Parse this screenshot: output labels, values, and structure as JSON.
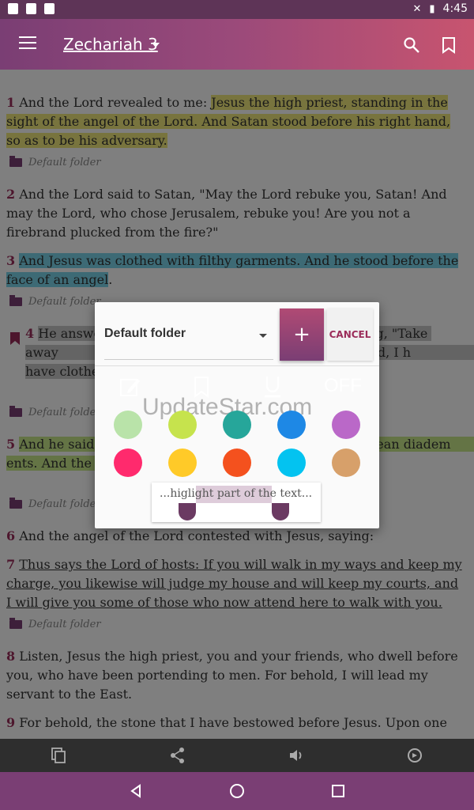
{
  "status_bar": {
    "time": "4:45"
  },
  "appbar": {
    "title": "Zechariah 3"
  },
  "verses": [
    {
      "num": "1",
      "plain": "And the Lord revealed to me: ",
      "hl": "Jesus the high priest, standing in the sight of the angel of the Lord. And Satan stood before his right hand, so as to be his adversary.",
      "folder": "Default folder"
    },
    {
      "num": "2",
      "plain": "And the Lord said to Satan, \"May the Lord rebuke you, Satan! And may the Lord, who chose Jerusalem, rebuke you! Are you not a firebrand plucked from the fire?\""
    },
    {
      "num": "3",
      "hl": "And Jesus was clothed with filthy garments. And he stood before the face of an angel",
      "after": ".",
      "folder": "Default folder"
    },
    {
      "num": "4",
      "hl": "He answe                                                        n, saying, \"Take away                                                          o him, \"Behold, I h                                                      have clothed you with a",
      "folder": "Default folder"
    },
    {
      "num": "5",
      "hl": "And he said,                                                    placed a clean diadem                                                   ents. And the angel of th",
      "folder": "Default folder"
    },
    {
      "num": "6",
      "plain": "And the angel of the Lord contested with Jesus, saying:"
    },
    {
      "num": "7",
      "ul": "Thus says the Lord of hosts: If you will walk in my ways and keep my charge, you likewise will judge my house and will keep my courts, and I will give you some of those who now attend here to walk with you.",
      "folder": "Default folder"
    },
    {
      "num": "8",
      "plain": "Listen, Jesus the high priest, you and your friends, who dwell before you, who have been portending to men. For behold, I will lead my servant to the East."
    },
    {
      "num": "9",
      "plain": "For behold, the stone that I have bestowed before Jesus. Upon one"
    }
  ],
  "dialog": {
    "folder_value": "Default folder",
    "add_label": "+",
    "cancel_label": "CANCEL",
    "off_label": "OFF",
    "watermark": "UpdateStar.com",
    "preview_text": "...higlight part of the text...",
    "colors": [
      "#b9e3a9",
      "#c6e34d",
      "#26a69a",
      "#1e88e5",
      "#ba68c8",
      "#ff2a6d",
      "#ffca28",
      "#f4511e",
      "#03c3f0",
      "#d7a06a"
    ]
  }
}
